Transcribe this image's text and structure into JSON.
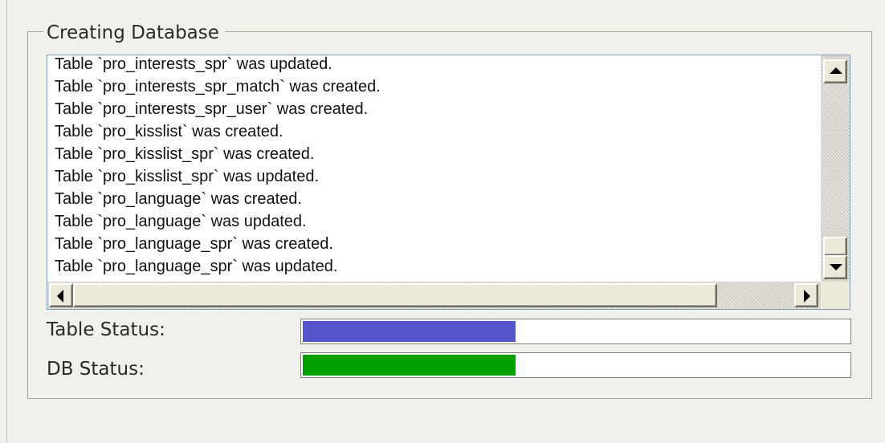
{
  "group": {
    "title": "Creating Database"
  },
  "log": {
    "lines": [
      "Table `pro_interests_spr` was updated.",
      "Table `pro_interests_spr_match` was created.",
      "Table `pro_interests_spr_user` was created.",
      "Table `pro_kisslist` was created.",
      "Table `pro_kisslist_spr` was created.",
      "Table `pro_kisslist_spr` was updated.",
      "Table `pro_language` was created.",
      "Table `pro_language` was updated.",
      "Table `pro_language_spr` was created.",
      "Table `pro_language_spr` was updated."
    ]
  },
  "icons": {
    "scroll_up": "scroll-up-arrow-icon",
    "scroll_down": "scroll-down-arrow-icon",
    "scroll_left": "scroll-left-arrow-icon",
    "scroll_right": "scroll-right-arrow-icon"
  },
  "status": {
    "table": {
      "label": "Table Status:",
      "progress": 0.39,
      "color": "#5656cc"
    },
    "db": {
      "label": "DB Status:",
      "progress": 0.39,
      "color": "#00a000"
    }
  }
}
